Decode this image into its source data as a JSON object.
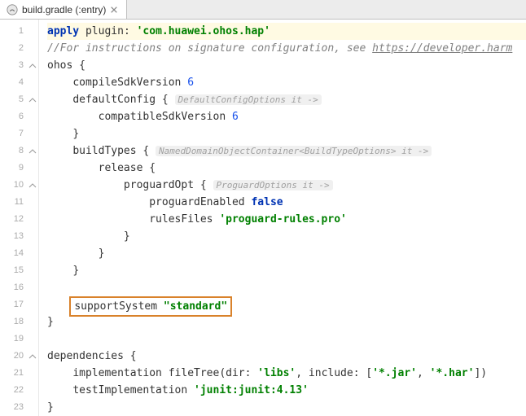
{
  "tab": {
    "label": "build.gradle (:entry)"
  },
  "code": {
    "l1_apply": "apply",
    "l1_plugin": "plugin",
    "l1_value": "'com.huawei.ohos.hap'",
    "l2_comment": "//For instructions on signature configuration, see ",
    "l2_link": "https://developer.harm",
    "l3": "ohos {",
    "l4": "compileSdkVersion ",
    "l4_num": "6",
    "l5": "defaultConfig { ",
    "l5_hint": "DefaultConfigOptions it ->",
    "l6": "compatibleSdkVersion ",
    "l6_num": "6",
    "l7": "}",
    "l8": "buildTypes { ",
    "l8_hint": "NamedDomainObjectContainer<BuildTypeOptions> it ->",
    "l9": "release {",
    "l10": "proguardOpt { ",
    "l10_hint": "ProguardOptions it ->",
    "l11": "proguardEnabled ",
    "l11_bool": "false",
    "l12": "rulesFiles ",
    "l12_str": "'proguard-rules.pro'",
    "l13": "}",
    "l14": "}",
    "l15": "}",
    "l17_a": "supportSystem ",
    "l17_b": "\"standard\"",
    "l18": "}",
    "l20": "dependencies {",
    "l21_a": "implementation fileTree(",
    "l21_dir": "dir",
    "l21_dirv": "'libs'",
    "l21_inc": "include",
    "l21_jar": "'*.jar'",
    "l21_har": "'*.har'",
    "l22_a": "testImplementation ",
    "l22_b": "'junit:junit:4.13'",
    "l23": "}"
  },
  "line_numbers": [
    "1",
    "2",
    "3",
    "4",
    "5",
    "6",
    "7",
    "8",
    "9",
    "10",
    "11",
    "12",
    "13",
    "14",
    "15",
    "16",
    "17",
    "18",
    "19",
    "20",
    "21",
    "22",
    "23"
  ]
}
